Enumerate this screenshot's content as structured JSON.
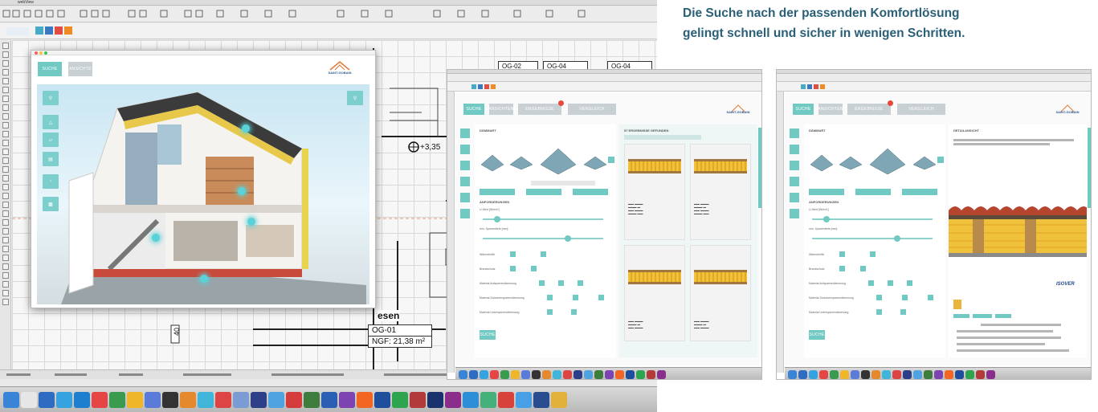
{
  "headline": {
    "line1": "Die Suche nach der passenden Komfortlösung",
    "line2": "gelingt schnell und sicher in wenigen Schritten."
  },
  "cad": {
    "app_title": "webView",
    "room_labels": [
      "OG-02",
      "OG-04",
      "OG-04"
    ],
    "room_name_partial": "esen",
    "room_code": "OG-01",
    "room_area": "NGF: 21,38 m²",
    "level_marker": "+3,35",
    "dimension": "40"
  },
  "plugin": {
    "tab_active": "SUCHE",
    "tab_other": "ANSICHTE",
    "brand": "SAINT-GOBAIN",
    "side_buttons": [
      "",
      "",
      "",
      "",
      "",
      ""
    ]
  },
  "results_window": {
    "brand": "SAINT-GOBAIN",
    "tabs": [
      "SUCHE",
      "ANSICHTEN",
      "ERGEBNISSE",
      "VERGLEICH"
    ],
    "left_title": "DÄMMART",
    "requirements_title": "ANFORDERUNGEN",
    "field_u": "U-Wert [W/m²K]",
    "field_depth": "min. Sparrentiefe [mm]",
    "row_waermeleitfaehigkeit": "Wärmeleitfä.",
    "row_brandschutz": "Brandschutz",
    "row_auf": "Material Aufsparrendämmung",
    "row_zwischen": "Material Zwischensparrendämmung",
    "row_unter": "Material Untersparrendämmung",
    "result_title": "57 ERGEBNISSE GEFUNDEN",
    "search_btn": "SUCHE",
    "result_cards": 4
  },
  "detail_window": {
    "brand": "SAINT-GOBAIN",
    "detail_title": "DETAILANSICHT",
    "isover": "ISOVER"
  }
}
